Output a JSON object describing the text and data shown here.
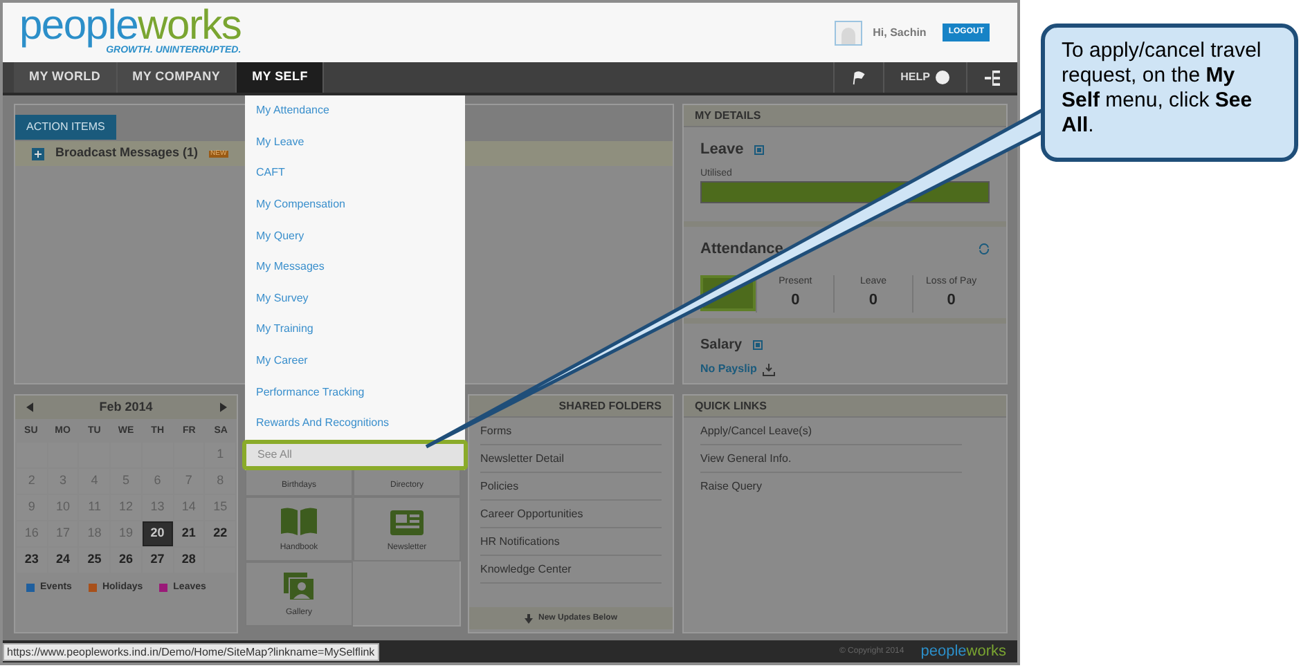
{
  "header": {
    "logo": {
      "text": "peopleworks",
      "tagline": "GROWTH. UNINTERRUPTED."
    },
    "greeting": "Hi, Sachin",
    "logout": "LOGOUT"
  },
  "nav": {
    "items": [
      {
        "label": "MY WORLD",
        "selected": false
      },
      {
        "label": "MY COMPANY",
        "selected": false
      },
      {
        "label": "MY SELF",
        "selected": true
      }
    ],
    "help": "HELP"
  },
  "dropdown": {
    "items": [
      {
        "label": "My Attendance",
        "highlighted": false
      },
      {
        "label": "My Leave",
        "highlighted": false
      },
      {
        "label": "CAFT",
        "highlighted": false
      },
      {
        "label": "My Compensation",
        "highlighted": false
      },
      {
        "label": "My Query",
        "highlighted": false
      },
      {
        "label": "My Messages",
        "highlighted": false
      },
      {
        "label": "My Survey",
        "highlighted": false
      },
      {
        "label": "My Training",
        "highlighted": false
      },
      {
        "label": "My Career",
        "highlighted": false
      },
      {
        "label": "Performance Tracking",
        "highlighted": false
      },
      {
        "label": "Rewards And Recognitions",
        "highlighted": false
      },
      {
        "label": "See All",
        "highlighted": true
      }
    ]
  },
  "action_items": {
    "tab": "ACTION ITEMS",
    "rows": [
      {
        "label": "Broadcast Messages (1)",
        "badge": "NEW"
      }
    ]
  },
  "calendar": {
    "month": "Feb 2014",
    "weekdays": [
      "SU",
      "MO",
      "TU",
      "WE",
      "TH",
      "FR",
      "SA"
    ],
    "weeks": [
      [
        {
          "kind": "blank"
        },
        {
          "kind": "blank"
        },
        {
          "kind": "blank"
        },
        {
          "kind": "blank"
        },
        {
          "kind": "blank"
        },
        {
          "kind": "blank"
        },
        {
          "kind": "day",
          "label": "1",
          "past": true,
          "selected": false
        }
      ],
      [
        {
          "label": "2",
          "past": true,
          "selected": false
        },
        {
          "label": "3",
          "past": true,
          "selected": false
        },
        {
          "label": "4",
          "past": true,
          "selected": false
        },
        {
          "label": "5",
          "past": true,
          "selected": false
        },
        {
          "label": "6",
          "past": true,
          "selected": false
        },
        {
          "label": "7",
          "past": true,
          "selected": false
        },
        {
          "label": "8",
          "past": true,
          "selected": false
        }
      ],
      [
        {
          "label": "9",
          "past": true,
          "selected": false
        },
        {
          "label": "10",
          "past": true,
          "selected": false
        },
        {
          "label": "11",
          "past": true,
          "selected": false
        },
        {
          "label": "12",
          "past": true,
          "selected": false
        },
        {
          "label": "13",
          "past": true,
          "selected": false
        },
        {
          "label": "14",
          "past": true,
          "selected": false
        },
        {
          "label": "15",
          "past": true,
          "selected": false
        }
      ],
      [
        {
          "label": "16",
          "past": true,
          "selected": false
        },
        {
          "label": "17",
          "past": true,
          "selected": false
        },
        {
          "label": "18",
          "past": true,
          "selected": false
        },
        {
          "label": "19",
          "past": true,
          "selected": false
        },
        {
          "label": "20",
          "past": false,
          "selected": true
        },
        {
          "label": "21",
          "past": false,
          "selected": false
        },
        {
          "label": "22",
          "past": false,
          "selected": false
        }
      ],
      [
        {
          "label": "23",
          "past": false,
          "selected": false
        },
        {
          "label": "24",
          "past": false,
          "selected": false
        },
        {
          "label": "25",
          "past": false,
          "selected": false
        },
        {
          "label": "26",
          "past": false,
          "selected": false
        },
        {
          "label": "27",
          "past": false,
          "selected": false
        },
        {
          "label": "28",
          "past": false,
          "selected": false
        },
        {
          "kind": "blank"
        }
      ]
    ],
    "legend": [
      {
        "label": "Events",
        "color": "#1f5f9e"
      },
      {
        "label": "Holidays",
        "color": "#a8501a"
      },
      {
        "label": "Leaves",
        "color": "#9a1a78"
      }
    ]
  },
  "tiles": [
    {
      "label": "Birthdays",
      "kind": "blank"
    },
    {
      "label": "Directory",
      "kind": "blank"
    },
    {
      "label": "Handbook",
      "kind": "book"
    },
    {
      "label": "Newsletter",
      "kind": "newspaper"
    },
    {
      "label": "Gallery",
      "kind": "photo"
    }
  ],
  "shared_folders": {
    "title": "SHARED FOLDERS",
    "items": [
      "Forms",
      "Newsletter Detail",
      "Policies",
      "Career Opportunities",
      "HR Notifications",
      "Knowledge Center"
    ],
    "footer": "New Updates Below"
  },
  "my_details": {
    "title": "MY DETAILS",
    "leave": {
      "title": "Leave",
      "caption": "Utilised",
      "level": 1
    },
    "attendance": {
      "title": "Attendance",
      "stats": [
        {
          "label": "Present",
          "value": "0"
        },
        {
          "label": "Leave",
          "value": "0"
        },
        {
          "label": "Loss of Pay",
          "value": "0"
        }
      ]
    },
    "salary": {
      "title": "Salary",
      "link": "No Payslip"
    }
  },
  "quick_links": {
    "title": "QUICK LINKS",
    "items": [
      "Apply/Cancel Leave(s)",
      "View General Info.",
      "Raise Query"
    ]
  },
  "footer": {
    "copyright": "© Copyright 2014",
    "logo": "peopleworks"
  },
  "status_url": "https://www.peopleworks.ind.in/Demo/Home/SiteMap?linkname=MySelflink",
  "callout": "To apply/cancel travel request, on the **My Self** menu, click **See All**."
}
